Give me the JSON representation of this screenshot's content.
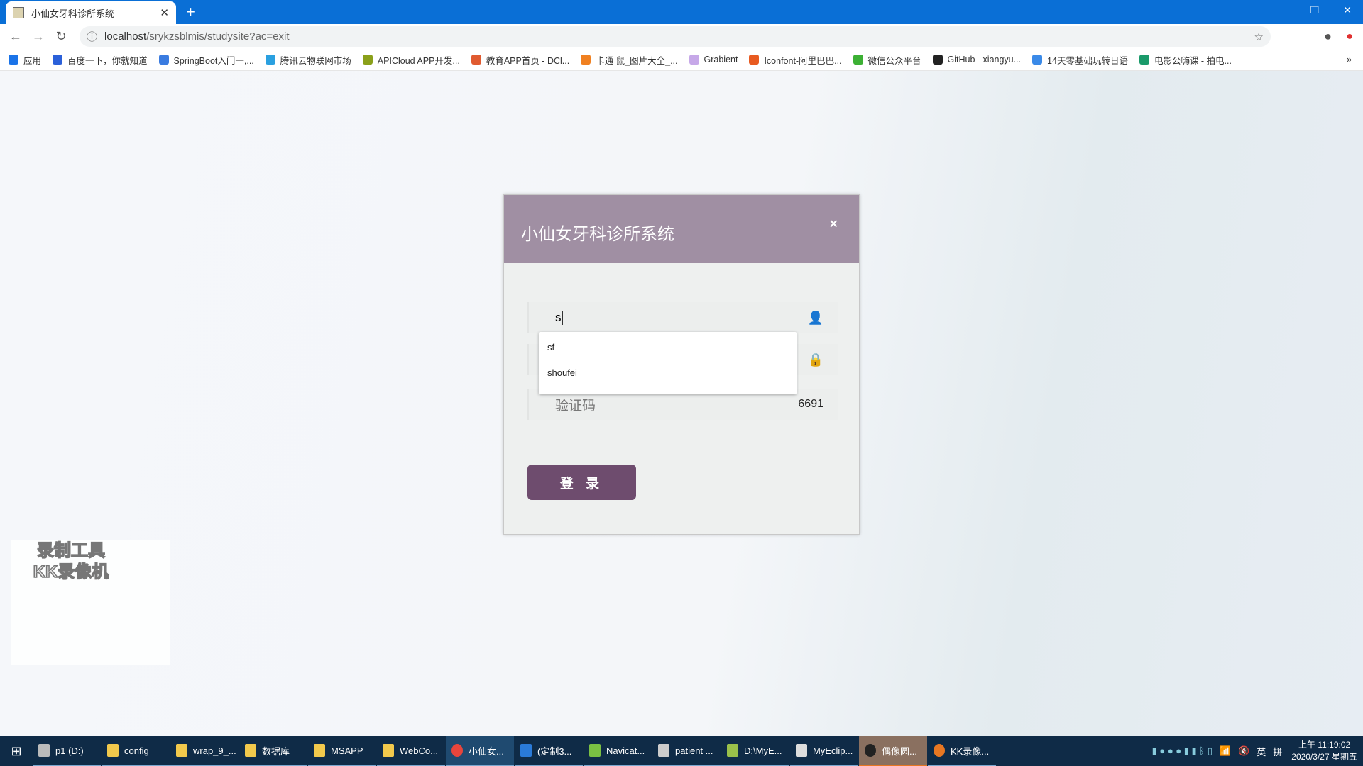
{
  "browser": {
    "tab_title": "小仙女牙科诊所系统",
    "url_host": "localhost",
    "url_path": "/srykzsblmis/studysite?ac=exit",
    "bookmarks": [
      {
        "label": "应用",
        "color": "#1a73e8"
      },
      {
        "label": "百度一下，你就知道",
        "color": "#2b60d9"
      },
      {
        "label": "SpringBoot入门一,...",
        "color": "#3a7be0"
      },
      {
        "label": "腾讯云物联网市场",
        "color": "#2aa0e0"
      },
      {
        "label": "APICloud APP开发...",
        "color": "#8aa01a"
      },
      {
        "label": "教育APP首页 - DCl...",
        "color": "#e05a30"
      },
      {
        "label": "卡通 鼠_图片大全_...",
        "color": "#f08020"
      },
      {
        "label": "Grabient",
        "color": "#c6a8e8"
      },
      {
        "label": "Iconfont-阿里巴巴...",
        "color": "#e85a20"
      },
      {
        "label": "微信公众平台",
        "color": "#3cb034"
      },
      {
        "label": "GitHub - xiangyu...",
        "color": "#222222"
      },
      {
        "label": "14天零基础玩转日语",
        "color": "#3a8ae8"
      },
      {
        "label": "电影公嗨课 - 拍电...",
        "color": "#1a9a6a"
      }
    ],
    "more": "»"
  },
  "login": {
    "title": "小仙女牙科诊所系统",
    "close": "×",
    "username_value": "s",
    "captcha_placeholder": "验证码",
    "captcha_code": "6691",
    "submit": "登 录",
    "suggestions": [
      "sf",
      "shoufei"
    ]
  },
  "watermark": "录制工具 KK录像机",
  "taskbar": {
    "items": [
      {
        "label": "p1 (D:)",
        "color": "#bbbbbb"
      },
      {
        "label": "config",
        "color": "#f2c94c"
      },
      {
        "label": "wrap_9_...",
        "color": "#f2c94c"
      },
      {
        "label": "数据库",
        "color": "#f2c94c"
      },
      {
        "label": "MSAPP",
        "color": "#f2c94c"
      },
      {
        "label": "WebCo...",
        "color": "#f2c94c"
      },
      {
        "label": "小仙女...",
        "color": "#e8453c"
      },
      {
        "label": "(定制3...",
        "color": "#2a7ad8"
      },
      {
        "label": "Navicat...",
        "color": "#7bc043"
      },
      {
        "label": "patient ...",
        "color": "#cccccc"
      },
      {
        "label": "D:\\MyE...",
        "color": "#9ac04a"
      },
      {
        "label": "MyEclip...",
        "color": "#dddddd"
      },
      {
        "label": "偶像圆...",
        "color": "#222222"
      },
      {
        "label": "KK录像...",
        "color": "#e87722"
      }
    ],
    "ime": "英",
    "ime2": "拼",
    "time": "上午 11:19:02",
    "date": "2020/3/27 星期五"
  }
}
